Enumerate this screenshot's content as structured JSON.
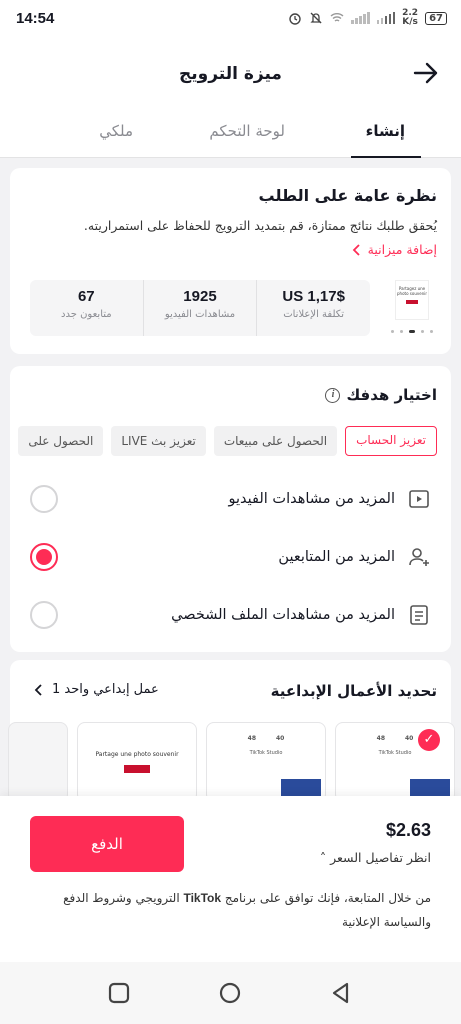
{
  "status": {
    "time": "14:54",
    "speed_value": "2.2",
    "speed_unit": "K/s",
    "battery": "67"
  },
  "header": {
    "title": "ميزة الترويج"
  },
  "tabs": [
    {
      "label": "إنشاء",
      "active": true
    },
    {
      "label": "لوحة التحكم",
      "active": false
    },
    {
      "label": "ملكي",
      "active": false
    }
  ],
  "overview": {
    "title": "نظرة عامة على الطلب",
    "description": "يُحقق طلبك نتائج ممتازة، قم بتمديد الترويج للحفاظ على استمراريته.",
    "add_budget": "إضافة ميزانية",
    "thumbnail_text": "Partagez une photo souvenir",
    "stats": [
      {
        "value": "US 1,17$",
        "label": "تكلفة الإعلانات"
      },
      {
        "value": "1925",
        "label": "مشاهدات الفيديو"
      },
      {
        "value": "67",
        "label": "متابعون جدد"
      }
    ]
  },
  "goal": {
    "title": "اختيار هدفك",
    "chips": [
      {
        "label": "تعزيز الحساب",
        "selected": true
      },
      {
        "label": "الحصول على مبيعات",
        "selected": false
      },
      {
        "label": "تعزيز بث LIVE",
        "selected": false
      },
      {
        "label": "الحصول على",
        "selected": false
      }
    ],
    "options": [
      {
        "label": "المزيد من مشاهدات الفيديو",
        "icon": "video-play-icon",
        "selected": false
      },
      {
        "label": "المزيد من المتابعين",
        "icon": "add-user-icon",
        "selected": true
      },
      {
        "label": "المزيد من مشاهدات الملف الشخصي",
        "icon": "profile-document-icon",
        "selected": false
      }
    ]
  },
  "creatives": {
    "title": "تحديد الأعمال الإبداعية",
    "selected_label": "عمل إبداعي واحد 1",
    "card_title": "TikTok Studio",
    "card_stats": [
      "40",
      "48"
    ],
    "photo_text": "Partage une photo souvenir"
  },
  "footer": {
    "price": "$2.63",
    "price_details": "انظر تفاصيل السعر",
    "pay_label": "الدفع",
    "terms_part1": "من خلال المتابعة، فإنك توافق على برنامج ",
    "terms_brand": "TikTok",
    "terms_part2": " الترويجي وشروط الدفع والسياسة الإعلانية"
  },
  "colors": {
    "accent": "#fe2c55",
    "text": "#161823",
    "muted": "#8a8b91"
  }
}
